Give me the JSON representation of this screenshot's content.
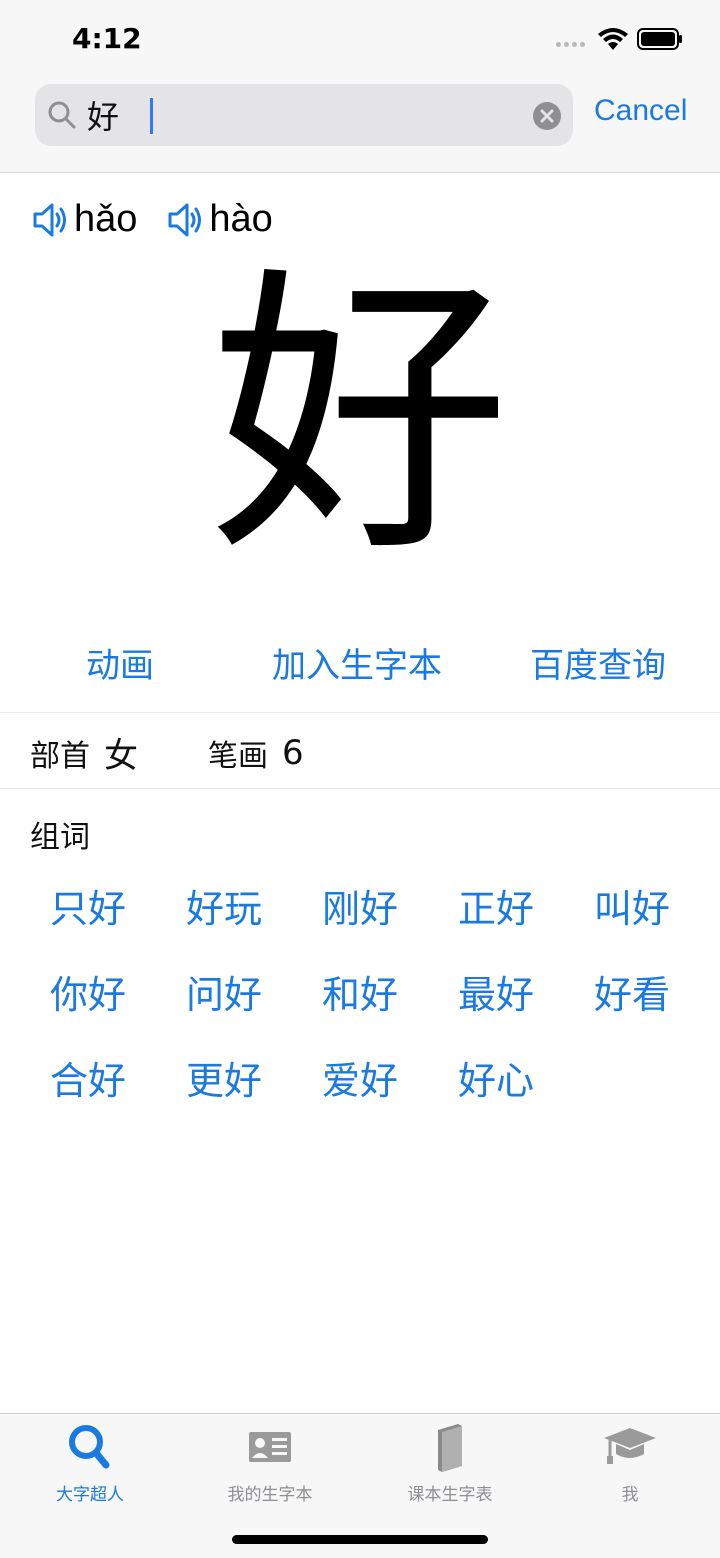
{
  "status_bar": {
    "time": "4:12"
  },
  "search": {
    "query": "好",
    "cancel_label": "Cancel"
  },
  "character": {
    "glyph": "好",
    "pinyin": [
      {
        "text": "hǎo"
      },
      {
        "text": "hào"
      }
    ]
  },
  "actions": {
    "animate": "动画",
    "add_to_book": "加入生字本",
    "baidu_search": "百度查询"
  },
  "info": {
    "radical_label": "部首",
    "radical_value": "女",
    "strokes_label": "笔画",
    "strokes_value": "6"
  },
  "words": {
    "title": "组词",
    "items": [
      "只好",
      "好玩",
      "刚好",
      "正好",
      "叫好",
      "你好",
      "问好",
      "和好",
      "最好",
      "好看",
      "合好",
      "更好",
      "爱好",
      "好心"
    ]
  },
  "tabs": [
    {
      "label": "大字超人",
      "icon": "search-icon",
      "active": true
    },
    {
      "label": "我的生字本",
      "icon": "id-card-icon",
      "active": false
    },
    {
      "label": "课本生字表",
      "icon": "book-icon",
      "active": false
    },
    {
      "label": "我",
      "icon": "graduation-cap-icon",
      "active": false
    }
  ],
  "colors": {
    "accent": "#1a7ae0",
    "tab_inactive": "#8e8e93",
    "header_bg": "#f7f7f7"
  }
}
